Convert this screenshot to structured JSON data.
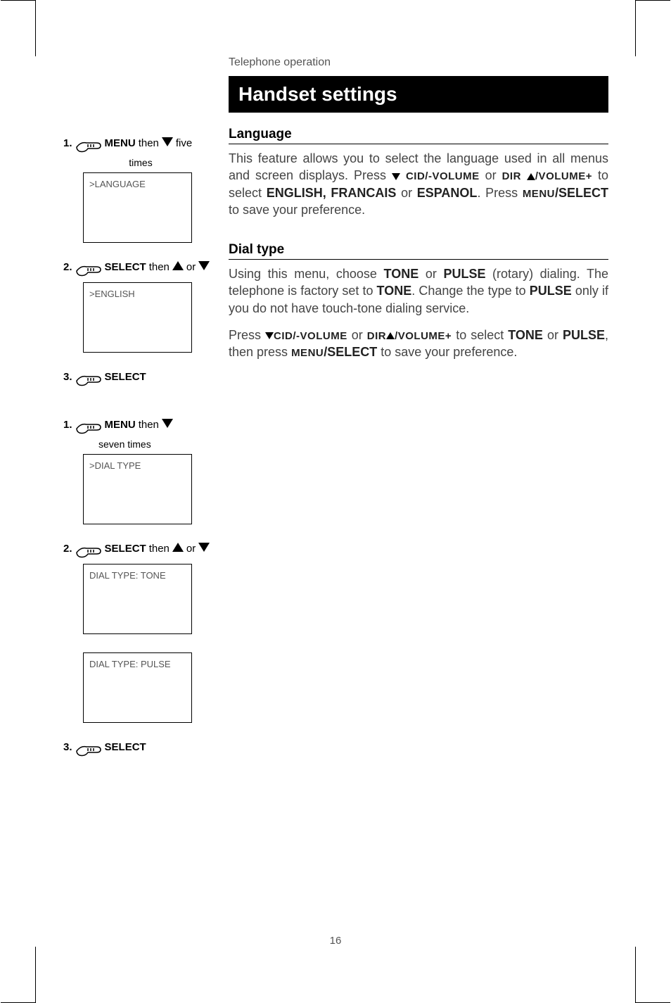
{
  "chapter": "Telephone operation",
  "title": "Handset settings",
  "page_number": "16",
  "language_section": {
    "heading": "Language",
    "body_parts": {
      "p1": "This feature allows you to select the language used in all menus and screen displays. Press ",
      "cid_vol": "CID/-VOLUME",
      "p2": " or ",
      "dir": "DIR",
      "vol_plus": "/VOLUME+",
      "p3": " to select ",
      "opts": "ENGLISH, FRANCAIS",
      "p4": " or ",
      "esp": "ESPANOL",
      "p5": ". Press ",
      "menu_sel": "MENU/SELECT",
      "p6": " to save your preference."
    }
  },
  "dialtype_section": {
    "heading": "Dial type",
    "body_parts": {
      "p1": "Using this menu, choose ",
      "tone": "TONE",
      "p2": " or ",
      "pulse": "PULSE",
      "p3": " (rotary) dialing. The telephone is factory set to ",
      "tone2": "TONE",
      "p4": ". Change the type to ",
      "pulse2": "PULSE",
      "p5": " only if you do not have touch-tone dialing service."
    },
    "body2_parts": {
      "p1": "Press ",
      "cid_vol": "CID/-VOLUME",
      "p2": " or ",
      "dir": "DIR",
      "vol_plus": "/VOLUME+",
      "p3": " to select ",
      "tone": "TONE",
      "p4": " or ",
      "pulse": "PULSE",
      "p5": ", then press ",
      "menu_sel": "MENU/SELECT",
      "p6": " to save your preference."
    }
  },
  "left": {
    "lang_steps": {
      "s1_num": "1.",
      "s1_menu": "MENU",
      "s1_then": " then ",
      "s1_five": " five",
      "s1_sub": "times",
      "s1_screen": ">LANGUAGE",
      "s2_num": "2.",
      "s2_select": "SELECT",
      "s2_then": " then ",
      "s2_or": " or ",
      "s2_screen": ">ENGLISH",
      "s3_num": "3.",
      "s3_select": "SELECT"
    },
    "dial_steps": {
      "s1_num": "1.",
      "s1_menu": "MENU",
      "s1_then": " then ",
      "s1_sub": "seven times",
      "s1_screen": ">DIAL TYPE",
      "s2_num": "2.",
      "s2_select": "SELECT",
      "s2_then": " then ",
      "s2_or": " or",
      "s2_screen_a": "DIAL TYPE: TONE",
      "s2_screen_b": "DIAL TYPE: PULSE",
      "s3_num": "3.",
      "s3_select": "SELECT"
    }
  }
}
